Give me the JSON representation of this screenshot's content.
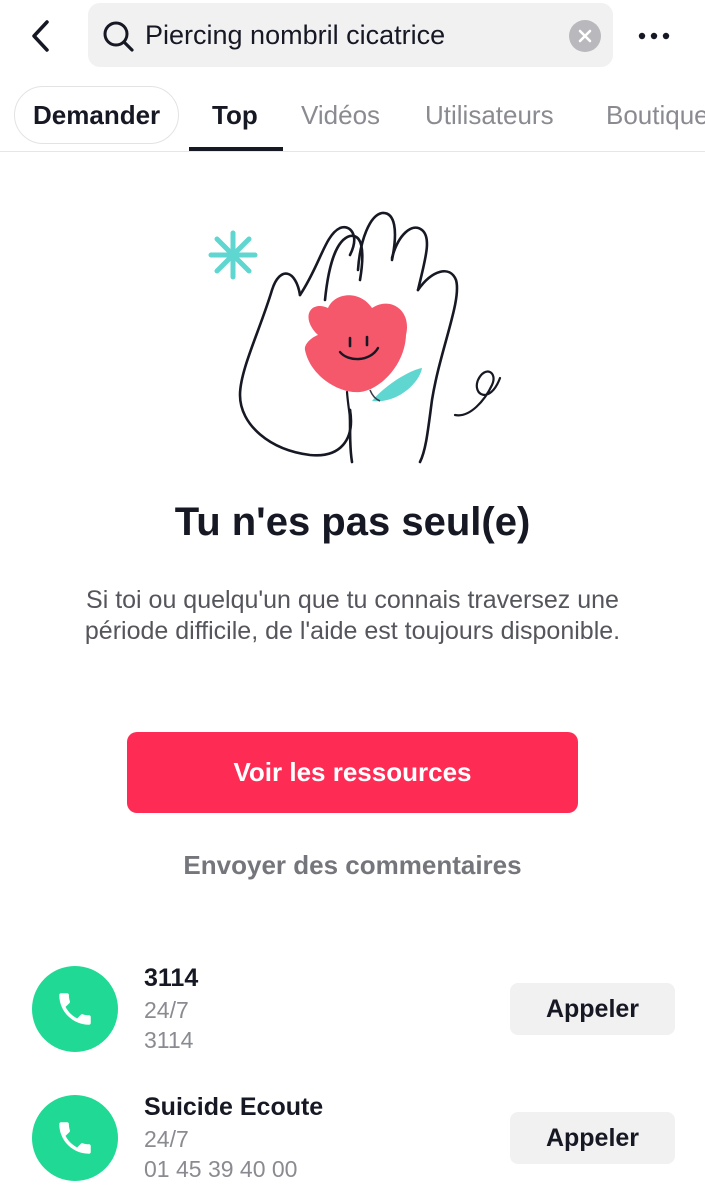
{
  "search": {
    "query": "Piercing nombril cicatrice",
    "icons": {
      "back": "chevron-left-icon",
      "search": "search-icon",
      "clear": "close-circle-icon",
      "more": "more-dots-icon"
    }
  },
  "tabs": {
    "ask_label": "Demander",
    "items": [
      {
        "label": "Top",
        "active": true
      },
      {
        "label": "Vidéos",
        "active": false
      },
      {
        "label": "Utilisateurs",
        "active": false
      },
      {
        "label": "Boutique",
        "active": false
      }
    ]
  },
  "support": {
    "illustration": "hands-holding-heart-illustration",
    "headline": "Tu n'es pas seul(e)",
    "message": "Si toi ou quelqu'un que tu connais traversez une période difficile, de l'aide est toujours disponible.",
    "resources_button": "Voir les ressources",
    "feedback_link": "Envoyer des commentaires"
  },
  "helplines": [
    {
      "name": "3114",
      "hours": "24/7",
      "number": "3114",
      "call_label": "Appeler"
    },
    {
      "name": "Suicide Ecoute",
      "hours": "24/7",
      "number": "01 45 39 40 00",
      "call_label": "Appeler"
    }
  ],
  "colors": {
    "accent": "#fe2c55",
    "phone_green": "#1fd994",
    "text_primary": "#161823",
    "text_secondary": "#8a8b91",
    "heart_pink": "#f5576b",
    "leaf_teal": "#5fd6d0"
  }
}
